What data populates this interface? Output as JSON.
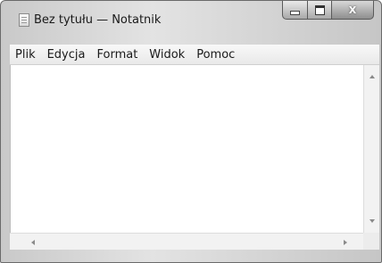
{
  "window": {
    "title": "Bez tytułu — Notatnik",
    "icon": "notepad-icon"
  },
  "caption_buttons": {
    "minimize_icon": "minimize-icon",
    "maximize_icon": "maximize-icon",
    "close_label": "X"
  },
  "menu": {
    "items": [
      {
        "label": "Plik"
      },
      {
        "label": "Edycja"
      },
      {
        "label": "Format"
      },
      {
        "label": "Widok"
      },
      {
        "label": "Pomoc"
      }
    ]
  },
  "editor": {
    "text": ""
  },
  "colors": {
    "frame": "#d4d4d4",
    "menubar": "#f0f0f0",
    "edit_background": "#ffffff"
  }
}
